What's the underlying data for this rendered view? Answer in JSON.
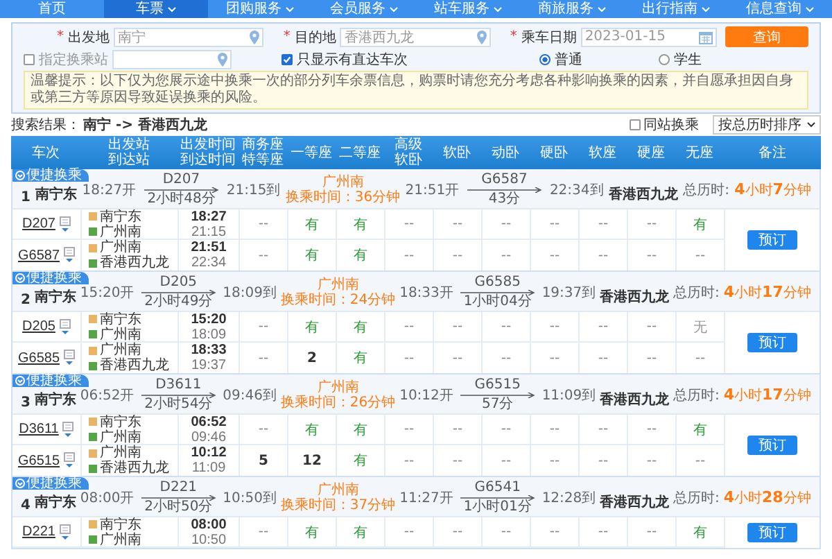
{
  "nav": [
    {
      "label": "首页",
      "caret": false,
      "selected": false
    },
    {
      "label": "车票",
      "caret": true,
      "selected": true
    },
    {
      "label": "团购服务",
      "caret": true,
      "selected": false
    },
    {
      "label": "会员服务",
      "caret": true,
      "selected": false
    },
    {
      "label": "站车服务",
      "caret": true,
      "selected": false
    },
    {
      "label": "商旅服务",
      "caret": true,
      "selected": false
    },
    {
      "label": "出行指南",
      "caret": true,
      "selected": false
    },
    {
      "label": "信息查询",
      "caret": true,
      "selected": false
    }
  ],
  "search": {
    "fields": [
      {
        "mark": "*",
        "label": "出发地",
        "value": "南宁"
      },
      {
        "mark": "*",
        "label": "目的地",
        "value": "香港西九龙"
      },
      {
        "mark": "*",
        "label": "乘车日期",
        "value": "2023-01-15"
      }
    ],
    "submit": "查询",
    "transfer_station": {
      "label": "指定换乘站",
      "checked": false
    },
    "direct_only": {
      "label": "只显示有直达车次",
      "checked": true
    },
    "passenger_types": [
      {
        "label": "普通",
        "selected": true
      },
      {
        "label": "学生",
        "selected": false
      }
    ],
    "notice": "温馨提示：以下仅为您展示途中换乘一次的部分列车余票信息，购票时请您充分考虑各种影响换乘的因素，并自愿承担因自身或第三方等原因导致延误换乘的风险。"
  },
  "results": {
    "label": "搜索结果：",
    "route": "南宁 -> 香港西九龙",
    "same_station": {
      "label": "同站换乘",
      "checked": false
    },
    "sort": "按总历时排序"
  },
  "columns": [
    [
      "车次"
    ],
    [
      "出发站",
      "到达站"
    ],
    [
      "出发时间",
      "到达时间"
    ],
    [
      "商务座",
      "特等座"
    ],
    [
      "一等座"
    ],
    [
      "二等座"
    ],
    [
      "高级",
      "软卧"
    ],
    [
      "软卧"
    ],
    [
      "动卧"
    ],
    [
      "硬卧"
    ],
    [
      "软座"
    ],
    [
      "硬座"
    ],
    [
      "无座"
    ],
    [
      "备注"
    ]
  ],
  "groups": [
    {
      "badge": "便捷换乘",
      "index": "1",
      "from": "南宁东",
      "depart": "18:27开",
      "leg1": {
        "train": "D207",
        "duration": "2小时48分"
      },
      "arrive1": "21:15到",
      "transfer": "广州南",
      "transfer_time": "换乘时间：36分钟",
      "depart2": "21:51开",
      "leg2": {
        "train": "G6587",
        "duration": "43分"
      },
      "arrive2": "22:34到",
      "to": "香港西九龙",
      "total_label": "总历时:",
      "total": "**4**小时**7**分钟",
      "book": "预订",
      "rows": [
        {
          "train": "D207",
          "from": "南宁东",
          "to": "广州南",
          "dep": "18:27",
          "arr": "21:15",
          "seats": [
            {
              "text": "--",
              "kind": "na"
            },
            {
              "text": "有",
              "kind": "yes"
            },
            {
              "text": "有",
              "kind": "yes"
            },
            {
              "text": "--",
              "kind": "na"
            },
            {
              "text": "--",
              "kind": "na"
            },
            {
              "text": "--",
              "kind": "na"
            },
            {
              "text": "--",
              "kind": "na"
            },
            {
              "text": "--",
              "kind": "na"
            },
            {
              "text": "--",
              "kind": "na"
            },
            {
              "text": "有",
              "kind": "yes"
            }
          ]
        },
        {
          "train": "G6587",
          "from": "广州南",
          "to": "香港西九龙",
          "dep": "21:51",
          "arr": "22:34",
          "seats": [
            {
              "text": "--",
              "kind": "na"
            },
            {
              "text": "有",
              "kind": "yes"
            },
            {
              "text": "有",
              "kind": "yes"
            },
            {
              "text": "--",
              "kind": "na"
            },
            {
              "text": "--",
              "kind": "na"
            },
            {
              "text": "--",
              "kind": "na"
            },
            {
              "text": "--",
              "kind": "na"
            },
            {
              "text": "--",
              "kind": "na"
            },
            {
              "text": "--",
              "kind": "na"
            },
            {
              "text": "--",
              "kind": "na"
            }
          ]
        }
      ]
    },
    {
      "badge": "便捷换乘",
      "index": "2",
      "from": "南宁东",
      "depart": "15:20开",
      "leg1": {
        "train": "D205",
        "duration": "2小时49分"
      },
      "arrive1": "18:09到",
      "transfer": "广州南",
      "transfer_time": "换乘时间：24分钟",
      "depart2": "18:33开",
      "leg2": {
        "train": "G6585",
        "duration": "1小时04分"
      },
      "arrive2": "19:37到",
      "to": "香港西九龙",
      "total_label": "总历时:",
      "total": "**4**小时**17**分钟",
      "book": "预订",
      "rows": [
        {
          "train": "D205",
          "from": "南宁东",
          "to": "广州南",
          "dep": "15:20",
          "arr": "18:09",
          "seats": [
            {
              "text": "--",
              "kind": "na"
            },
            {
              "text": "有",
              "kind": "yes"
            },
            {
              "text": "有",
              "kind": "yes"
            },
            {
              "text": "--",
              "kind": "na"
            },
            {
              "text": "--",
              "kind": "na"
            },
            {
              "text": "--",
              "kind": "na"
            },
            {
              "text": "--",
              "kind": "na"
            },
            {
              "text": "--",
              "kind": "na"
            },
            {
              "text": "--",
              "kind": "na"
            },
            {
              "text": "无",
              "kind": "none"
            }
          ]
        },
        {
          "train": "G6585",
          "from": "广州南",
          "to": "香港西九龙",
          "dep": "18:33",
          "arr": "19:37",
          "seats": [
            {
              "text": "--",
              "kind": "na"
            },
            {
              "text": "2",
              "kind": "count"
            },
            {
              "text": "有",
              "kind": "yes"
            },
            {
              "text": "--",
              "kind": "na"
            },
            {
              "text": "--",
              "kind": "na"
            },
            {
              "text": "--",
              "kind": "na"
            },
            {
              "text": "--",
              "kind": "na"
            },
            {
              "text": "--",
              "kind": "na"
            },
            {
              "text": "--",
              "kind": "na"
            },
            {
              "text": "--",
              "kind": "na"
            }
          ]
        }
      ]
    },
    {
      "badge": "便捷换乘",
      "index": "3",
      "from": "南宁东",
      "depart": "06:52开",
      "leg1": {
        "train": "D3611",
        "duration": "2小时54分"
      },
      "arrive1": "09:46到",
      "transfer": "广州南",
      "transfer_time": "换乘时间：26分钟",
      "depart2": "10:12开",
      "leg2": {
        "train": "G6515",
        "duration": "57分"
      },
      "arrive2": "11:09到",
      "to": "香港西九龙",
      "total_label": "总历时:",
      "total": "**4**小时**17**分钟",
      "book": "预订",
      "rows": [
        {
          "train": "D3611",
          "from": "南宁东",
          "to": "广州南",
          "dep": "06:52",
          "arr": "09:46",
          "seats": [
            {
              "text": "--",
              "kind": "na"
            },
            {
              "text": "有",
              "kind": "yes"
            },
            {
              "text": "有",
              "kind": "yes"
            },
            {
              "text": "--",
              "kind": "na"
            },
            {
              "text": "--",
              "kind": "na"
            },
            {
              "text": "--",
              "kind": "na"
            },
            {
              "text": "--",
              "kind": "na"
            },
            {
              "text": "--",
              "kind": "na"
            },
            {
              "text": "--",
              "kind": "na"
            },
            {
              "text": "有",
              "kind": "yes"
            }
          ]
        },
        {
          "train": "G6515",
          "from": "广州南",
          "to": "香港西九龙",
          "dep": "10:12",
          "arr": "11:09",
          "seats": [
            {
              "text": "5",
              "kind": "count"
            },
            {
              "text": "12",
              "kind": "count"
            },
            {
              "text": "有",
              "kind": "yes"
            },
            {
              "text": "--",
              "kind": "na"
            },
            {
              "text": "--",
              "kind": "na"
            },
            {
              "text": "--",
              "kind": "na"
            },
            {
              "text": "--",
              "kind": "na"
            },
            {
              "text": "--",
              "kind": "na"
            },
            {
              "text": "--",
              "kind": "na"
            },
            {
              "text": "--",
              "kind": "na"
            }
          ]
        }
      ]
    },
    {
      "badge": "便捷换乘",
      "index": "4",
      "from": "南宁东",
      "depart": "08:00开",
      "leg1": {
        "train": "D221",
        "duration": "2小时50分"
      },
      "arrive1": "10:50到",
      "transfer": "广州南",
      "transfer_time": "换乘时间：37分钟",
      "depart2": "11:27开",
      "leg2": {
        "train": "G6541",
        "duration": "1小时01分"
      },
      "arrive2": "12:28到",
      "to": "香港西九龙",
      "total_label": "总历时:",
      "total": "**4**小时**28**分钟",
      "book": "预订",
      "rows": [
        {
          "train": "D221",
          "from": "南宁东",
          "to": "广州南",
          "dep": "08:00",
          "arr": "10:50",
          "seats": [
            {
              "text": "--",
              "kind": "na"
            },
            {
              "text": "有",
              "kind": "yes"
            },
            {
              "text": "有",
              "kind": "yes"
            },
            {
              "text": "--",
              "kind": "na"
            },
            {
              "text": "--",
              "kind": "na"
            },
            {
              "text": "--",
              "kind": "na"
            },
            {
              "text": "--",
              "kind": "na"
            },
            {
              "text": "--",
              "kind": "na"
            },
            {
              "text": "--",
              "kind": "na"
            },
            {
              "text": "有",
              "kind": "yes"
            }
          ]
        }
      ]
    }
  ]
}
